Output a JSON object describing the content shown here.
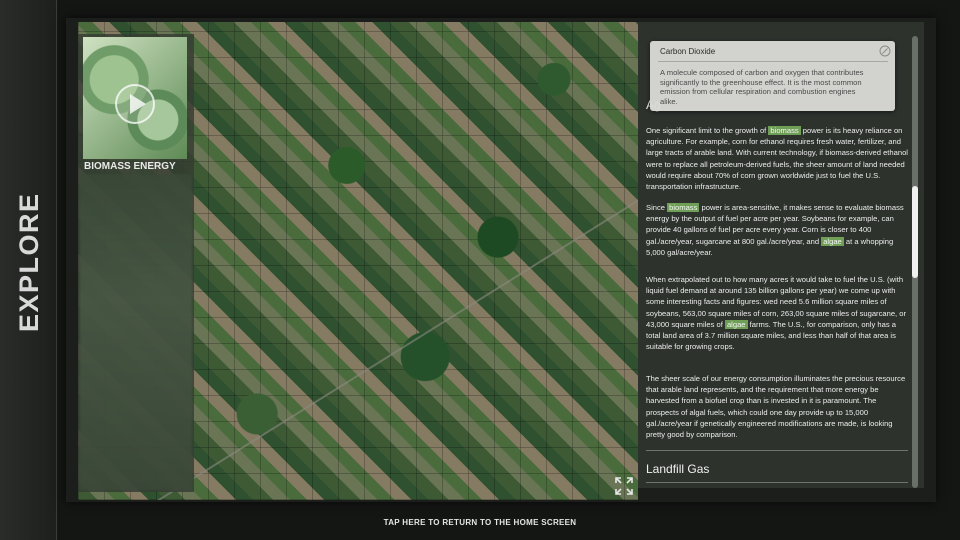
{
  "rail": {
    "label": "EXPLORE"
  },
  "video": {
    "label": "BIOMASS ENERGY"
  },
  "tooltip": {
    "title": "Carbon Dioxide",
    "text": "A molecule composed of carbon and oxygen that contributes significantly to the greenhouse effect. It is the most common emission from cellular respiration and combustion engines alike."
  },
  "article": {
    "heading_partial": "Ag",
    "p1": {
      "a": "One significant limit to the growth of ",
      "hl": "biomass",
      "b": " power is its heavy reliance on agriculture. For example, corn for ethanol requires fresh water, fertilizer, and large tracts of arable land. With current technology, if biomass-derived ethanol were to replace all petroleum-derived fuels, the sheer amount of land needed would require about 70% of corn grown worldwide just to fuel the U.S. transportation infrastructure."
    },
    "p2": {
      "a": "Since ",
      "hl1": "biomass",
      "b": " power is area-sensitive, it makes sense to evaluate biomass energy by the output of fuel per acre per year. Soybeans for example, can provide 40 gallons of fuel per acre every year. Corn is closer to 400 gal./acre/year, sugarcane at 800 gal./acre/year, and ",
      "hl2": "algae",
      "c": " at a whopping 5,000 gal/acre/year."
    },
    "p3": {
      "a": "When extrapolated out to how many acres it would take to fuel the U.S. (with liquid fuel demand at around 135 billion gallons per year) we come up with some interesting facts and figures: wed need 5.6 million square miles of soybeans, 563,00 square miles of corn, 263,00 square miles of sugarcane, or 43,000 square miles of ",
      "hl": "algae",
      "b": " farms. The U.S., for comparison, only has a total land area of 3.7 million square miles, and less than half of that area is suitable for growing crops."
    },
    "p4": "The sheer scale of our energy consumption illuminates the precious resource that arable land represents, and the requirement that more energy be harvested from a biofuel crop than is invested in it is paramount. The prospects of algal fuels, which could one day provide up to 15,000 gal./acre/year if genetically engineered modifications are made, is looking pretty good by comparison.",
    "next_section": "Landfill Gas"
  },
  "footer": {
    "home_link": "TAP HERE TO RETURN TO THE HOME SCREEN"
  },
  "icons": {
    "play": "play-icon",
    "expand": "expand-icon",
    "close": "close-icon"
  }
}
